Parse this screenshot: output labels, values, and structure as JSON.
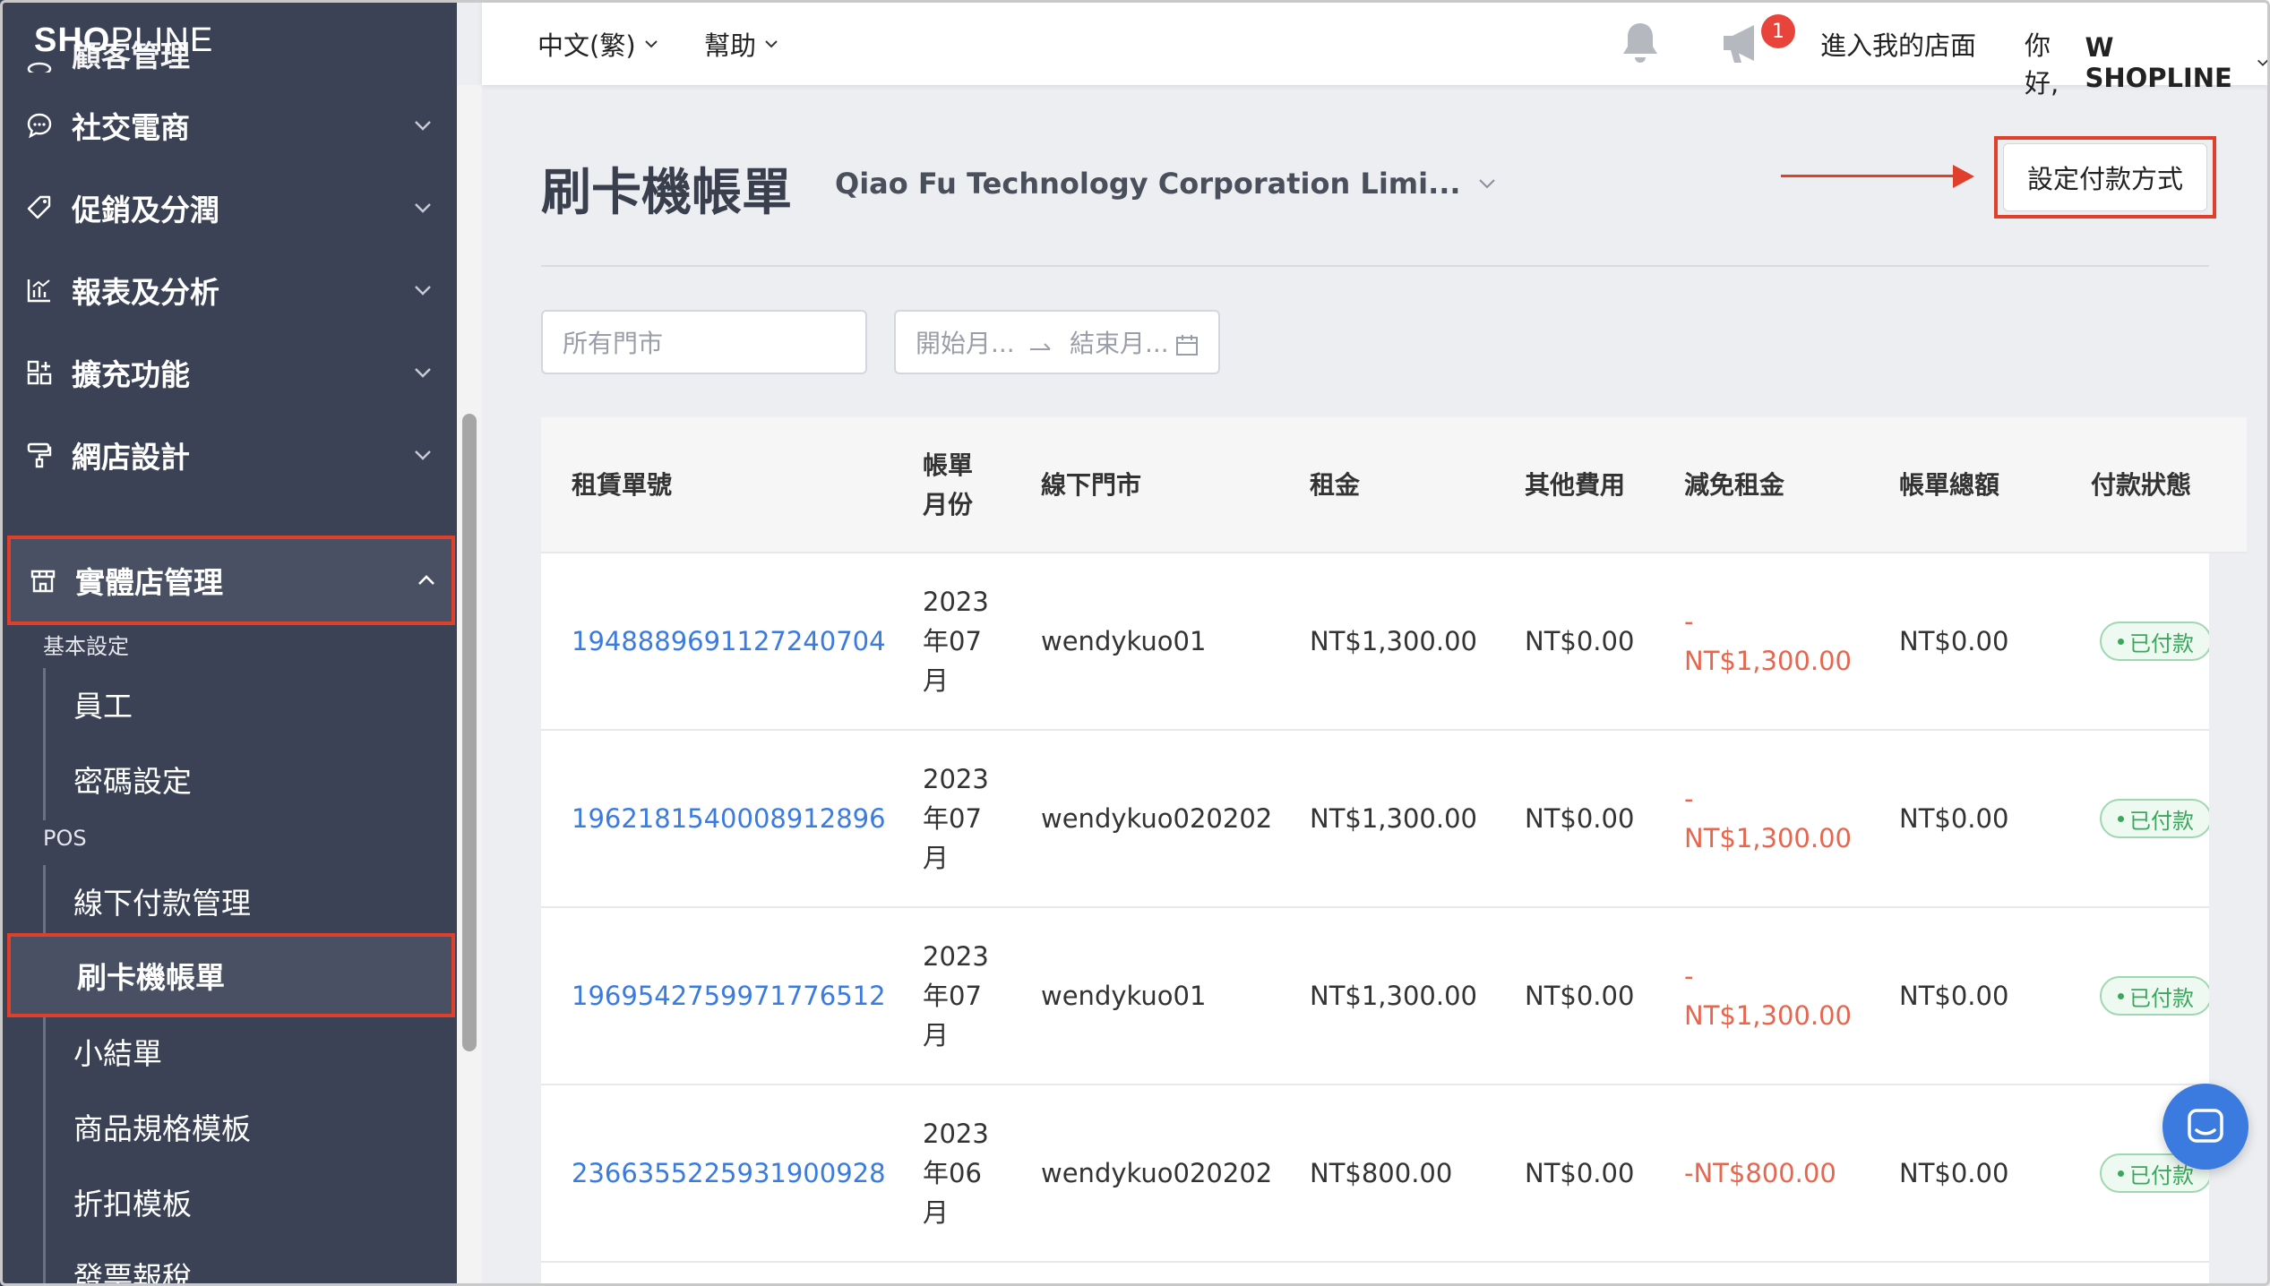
{
  "brand": {
    "logo_part1": "SH",
    "logo_part2": "O",
    "logo_part3": "P",
    "logo_part4": "LINE"
  },
  "sidebar": {
    "cut_item": "顧客管理",
    "items": [
      {
        "label": "社交電商",
        "icon": "chat-bubble-icon"
      },
      {
        "label": "促銷及分潤",
        "icon": "tag-icon"
      },
      {
        "label": "報表及分析",
        "icon": "chart-icon"
      },
      {
        "label": "擴充功能",
        "icon": "apps-icon"
      },
      {
        "label": "網店設計",
        "icon": "paint-roller-icon"
      },
      {
        "label": "實體店管理",
        "icon": "store-icon"
      }
    ],
    "group_basic": "基本設定",
    "basic_items": [
      "員工",
      "密碼設定"
    ],
    "group_pos": "POS",
    "pos_items": [
      "線下付款管理",
      "刷卡機帳單",
      "小結單",
      "商品規格模板",
      "折扣模板",
      "發票報稅"
    ]
  },
  "topbar": {
    "language": "中文(繁)",
    "help": "幫助",
    "notification_count": "1",
    "store_link": "進入我的店面",
    "greeting_prefix": "你好, ",
    "greeting_name": "W SHOPLINE"
  },
  "page": {
    "title": "刷卡機帳單",
    "company": "Qiao Fu Technology Corporation Limi...",
    "set_payment_button": "設定付款方式"
  },
  "filters": {
    "store_placeholder": "所有門市",
    "start_placeholder": "開始月...",
    "end_placeholder": "結束月..."
  },
  "table": {
    "headers": {
      "rental_no": "租賃單號",
      "bill_month_1": "帳單",
      "bill_month_2": "月份",
      "store": "線下門市",
      "rent": "租金",
      "other": "其他費用",
      "waiver": "減免租金",
      "total": "帳單總額",
      "status": "付款狀態"
    },
    "rows": [
      {
        "id": "1948889691127240704",
        "y": "2023",
        "m": "年07",
        "u": "月",
        "store": "wendykuo01",
        "rent": "NT$1,300.00",
        "other": "NT$0.00",
        "waiver_a": "-",
        "waiver_b": "NT$1,300.00",
        "total": "NT$0.00",
        "status": "已付款"
      },
      {
        "id": "1962181540008912896",
        "y": "2023",
        "m": "年07",
        "u": "月",
        "store": "wendykuo020202",
        "rent": "NT$1,300.00",
        "other": "NT$0.00",
        "waiver_a": "-",
        "waiver_b": "NT$1,300.00",
        "total": "NT$0.00",
        "status": "已付款"
      },
      {
        "id": "1969542759971776512",
        "y": "2023",
        "m": "年07",
        "u": "月",
        "store": "wendykuo01",
        "rent": "NT$1,300.00",
        "other": "NT$0.00",
        "waiver_a": "-",
        "waiver_b": "NT$1,300.00",
        "total": "NT$0.00",
        "status": "已付款"
      },
      {
        "id": "2366355225931900928",
        "y": "2023",
        "m": "年06",
        "u": "月",
        "store": "wendykuo020202",
        "rent": "NT$800.00",
        "other": "NT$0.00",
        "waiver_a": "",
        "waiver_b": "-NT$800.00",
        "total": "NT$0.00",
        "status": "已付款"
      }
    ]
  }
}
